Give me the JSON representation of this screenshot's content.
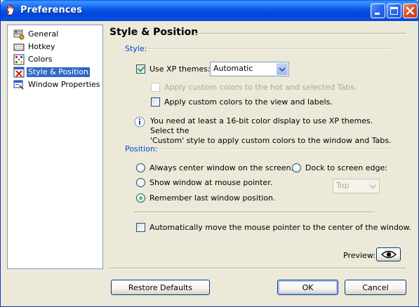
{
  "window": {
    "title": "Preferences",
    "icon": "app-hand-icon",
    "controls": [
      "minimize",
      "maximize",
      "close"
    ]
  },
  "nav": {
    "items": [
      {
        "label": "General",
        "icon": "general-settings-icon",
        "selected": false
      },
      {
        "label": "Hotkey",
        "icon": "keyboard-icon",
        "selected": false
      },
      {
        "label": "Colors",
        "icon": "colors-icon",
        "selected": false
      },
      {
        "label": "Style & Position",
        "icon": "style-position-icon",
        "selected": true
      },
      {
        "label": "Window Properties",
        "icon": "window-properties-icon",
        "selected": false
      }
    ]
  },
  "main": {
    "title": "Style & Position",
    "style_group": {
      "label": "Style:",
      "use_xp_themes": {
        "label": "Use XP themes:",
        "checked": true
      },
      "theme_select": {
        "value": "Automatic"
      },
      "custom_hot_tabs": {
        "label": "Apply custom colors to the hot and selected Tabs.",
        "checked": false,
        "disabled": true
      },
      "custom_view_labels": {
        "label": "Apply custom colors to the view and labels.",
        "checked": false,
        "disabled": false
      },
      "info_line1": "You need at least a 16-bit color display to use XP themes. Select the",
      "info_line2": "'Custom' style to apply custom colors to the window and Tabs."
    },
    "position_group": {
      "label": "Position:",
      "always_center": {
        "label": "Always center window on the screen.",
        "checked": false
      },
      "dock_edge": {
        "label": "Dock to screen edge:",
        "checked": false
      },
      "show_at_pointer": {
        "label": "Show window at mouse pointer.",
        "checked": false
      },
      "dock_select": {
        "value": "Top",
        "disabled": true
      },
      "remember_last": {
        "label": "Remember last window position.",
        "checked": true
      }
    },
    "move_pointer": {
      "label": "Automatically move the mouse pointer to the center of the window.",
      "checked": false
    },
    "preview_label": "Preview:",
    "preview_icon": "eye-icon"
  },
  "footer": {
    "restore_defaults": "Restore Defaults",
    "ok": "OK",
    "cancel": "Cancel"
  },
  "colors": {
    "titlebar": "#0758E8",
    "face": "#ECE9D8",
    "group_label": "#0046D5",
    "selection": "#316AC5"
  }
}
